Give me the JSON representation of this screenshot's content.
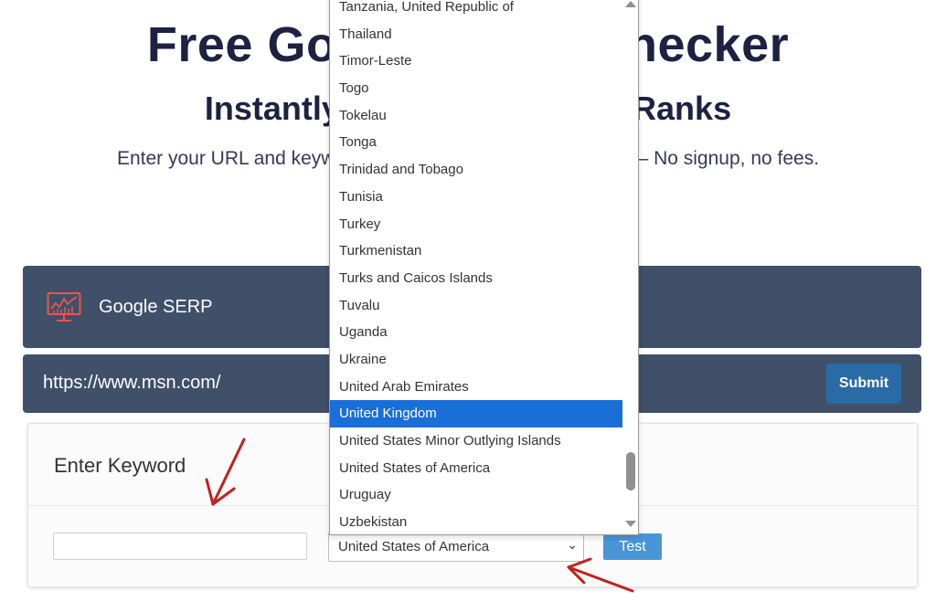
{
  "hero": {
    "title": "Free Google Rank Checker",
    "subtitle": "Instantly See Your Website Ranks",
    "description": "Enter your URL and keyword to check Google SERP ranking – No signup, no fees."
  },
  "serp_bar": {
    "icon": "chart-monitor-icon",
    "label": "Google SERP"
  },
  "url_bar": {
    "url": "https://www.msn.com/",
    "submit_label": "Submit"
  },
  "keyword_card": {
    "title": "Enter Keyword",
    "keyword_value": "",
    "country_selected": "United States of America",
    "test_label": "Test"
  },
  "country_dropdown": {
    "options": [
      "Tanzania, United Republic of",
      "Thailand",
      "Timor-Leste",
      "Togo",
      "Tokelau",
      "Tonga",
      "Trinidad and Tobago",
      "Tunisia",
      "Turkey",
      "Turkmenistan",
      "Turks and Caicos Islands",
      "Tuvalu",
      "Uganda",
      "Ukraine",
      "United Arab Emirates",
      "United Kingdom",
      "United States Minor Outlying Islands",
      "United States of America",
      "Uruguay",
      "Uzbekistan"
    ],
    "highlighted": "United Kingdom"
  },
  "colors": {
    "panel": "#3f5068",
    "submit": "#2a6aa5",
    "test": "#4a95d6",
    "highlight": "#1a6ed8",
    "annotation_arrow": "#c0221f"
  }
}
